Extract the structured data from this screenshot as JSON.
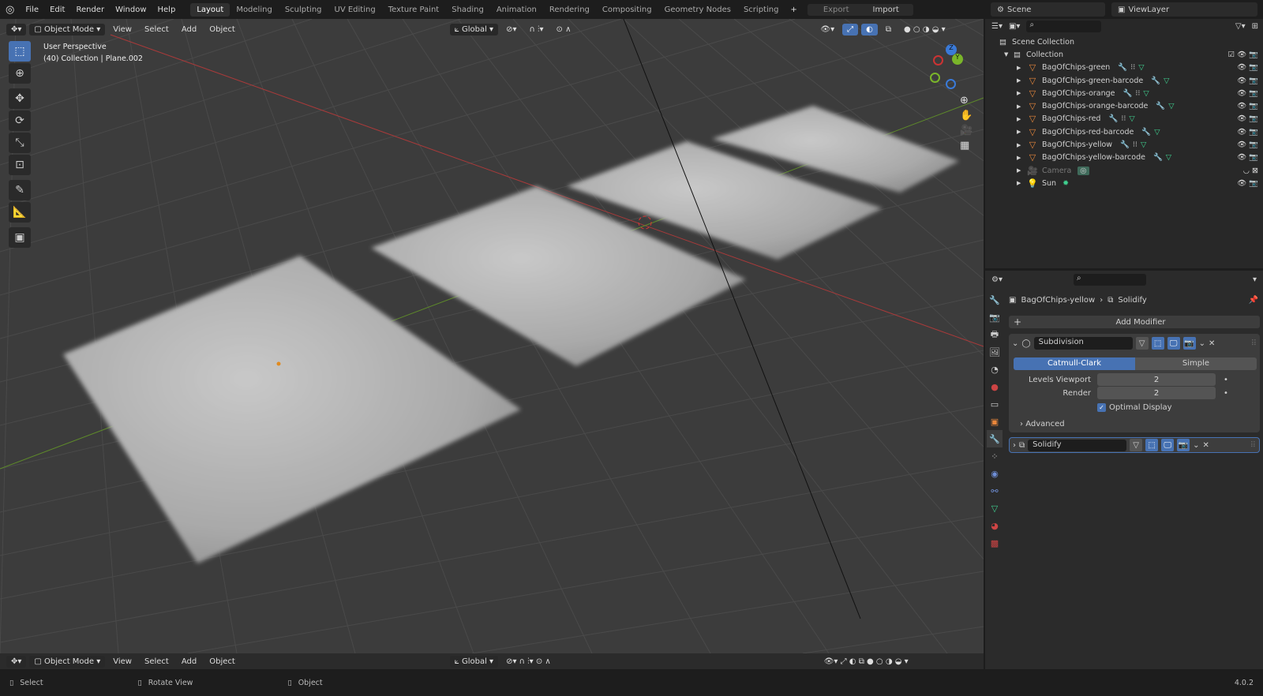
{
  "menubar": {
    "items": [
      "File",
      "Edit",
      "Render",
      "Window",
      "Help"
    ],
    "workspaces": [
      "Layout",
      "Modeling",
      "Sculpting",
      "UV Editing",
      "Texture Paint",
      "Shading",
      "Animation",
      "Rendering",
      "Compositing",
      "Geometry Nodes",
      "Scripting"
    ],
    "active_workspace": "Layout",
    "add": "+",
    "export": "Export",
    "import": "Import",
    "scene": "Scene",
    "view_layer": "ViewLayer"
  },
  "viewport": {
    "mode": "Object Mode",
    "menus": [
      "View",
      "Select",
      "Add",
      "Object"
    ],
    "transform": "Global",
    "overlay_title": "User Perspective",
    "overlay_sub": "(40) Collection | Plane.002",
    "gizmo": {
      "x": "X",
      "y": "Y",
      "z": "Z"
    }
  },
  "outliner": {
    "scene_collection": "Scene Collection",
    "collection": "Collection",
    "items": [
      {
        "name": "BagOfChips-green",
        "type": "mesh",
        "mods": true,
        "extra": true
      },
      {
        "name": "BagOfChips-green-barcode",
        "type": "mesh",
        "mods": true,
        "extra": false
      },
      {
        "name": "BagOfChips-orange",
        "type": "mesh",
        "mods": true,
        "extra": true
      },
      {
        "name": "BagOfChips-orange-barcode",
        "type": "mesh",
        "mods": true,
        "extra": false
      },
      {
        "name": "BagOfChips-red",
        "type": "mesh",
        "mods": true,
        "extra": true
      },
      {
        "name": "BagOfChips-red-barcode",
        "type": "mesh",
        "mods": true,
        "extra": false
      },
      {
        "name": "BagOfChips-yellow",
        "type": "mesh",
        "mods": true,
        "extra": true
      },
      {
        "name": "BagOfChips-yellow-barcode",
        "type": "mesh",
        "mods": true,
        "extra": false
      },
      {
        "name": "Camera",
        "type": "camera"
      },
      {
        "name": "Sun",
        "type": "light"
      }
    ]
  },
  "properties": {
    "object": "BagOfChips-yellow",
    "modifier": "Solidify",
    "add_modifier": "Add Modifier",
    "subdivision": {
      "name": "Subdivision",
      "type_options": [
        "Catmull-Clark",
        "Simple"
      ],
      "selected": "Catmull-Clark",
      "levels_viewport_label": "Levels Viewport",
      "levels_viewport": "2",
      "render_label": "Render",
      "render": "2",
      "optimal_display_label": "Optimal Display",
      "optimal_display": true,
      "advanced": "Advanced"
    },
    "solidify": {
      "name": "Solidify"
    }
  },
  "status": {
    "select": "Select",
    "rotate": "Rotate View",
    "object": "Object",
    "version": "4.0.2"
  },
  "colors": {
    "accent": "#4772b3",
    "viewport_bg": "#3c3c3c",
    "x_axis": "#b03a3a",
    "y_axis": "#6a9a2a"
  }
}
